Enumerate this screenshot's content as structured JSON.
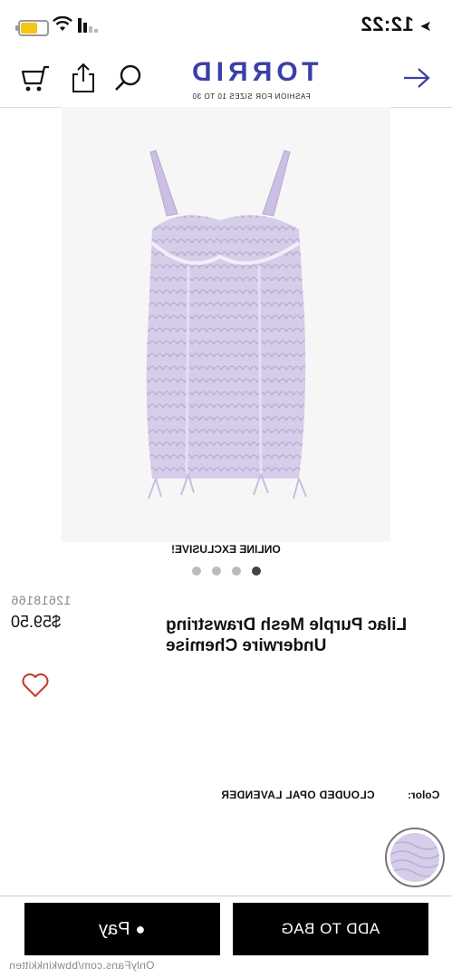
{
  "status_bar": {
    "time": "12:22",
    "battery_color": "#f5c518"
  },
  "header": {
    "logo": "TORRID",
    "tagline": "FASHION FOR SIZES 10 TO 30",
    "icons": [
      "cart-icon",
      "share-icon",
      "search-icon",
      "arrow-icon"
    ],
    "brand_color": "#3b3fa8"
  },
  "product": {
    "badge": "ONLINE EXCLUSIVE!",
    "carousel_dots": 4,
    "active_dot": 4,
    "sku": "12618166",
    "price": "$59.50",
    "title": "Lilac Purple Mesh Drawstring Underwire Chemise",
    "color_label": "Color:",
    "color_value": "CLOUDED OPAL LAVENDER",
    "swatch_color": "#d6cde9"
  },
  "actions": {
    "pay_label": "Pay",
    "add_to_bag_label": "ADD TO BAG"
  },
  "watermark": "OnlyFans.com/bbwkinkkitten"
}
